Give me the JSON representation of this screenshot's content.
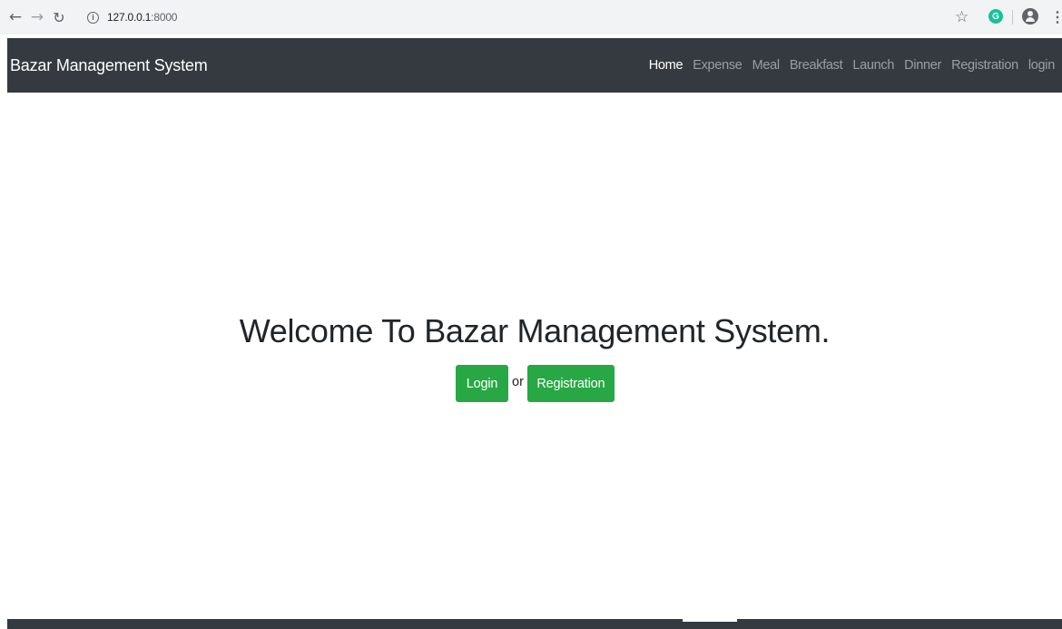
{
  "browser": {
    "url_host": "127.0.0.1",
    "url_port": ":8000",
    "info_icon": "i",
    "grammarly_label": "G"
  },
  "navbar": {
    "brand": "Bazar Management System",
    "links": [
      {
        "label": "Home",
        "active": true
      },
      {
        "label": "Expense"
      },
      {
        "label": "Meal"
      },
      {
        "label": "Breakfast"
      },
      {
        "label": "Launch"
      },
      {
        "label": "Dinner"
      },
      {
        "label": "Registration"
      },
      {
        "label": "login"
      }
    ]
  },
  "main": {
    "title": "Welcome To Bazar Management System.",
    "login_button": "Login",
    "or_text": "or",
    "registration_button": "Registration"
  },
  "colors": {
    "navbar_bg": "#343a40",
    "button_green": "#28a745"
  }
}
